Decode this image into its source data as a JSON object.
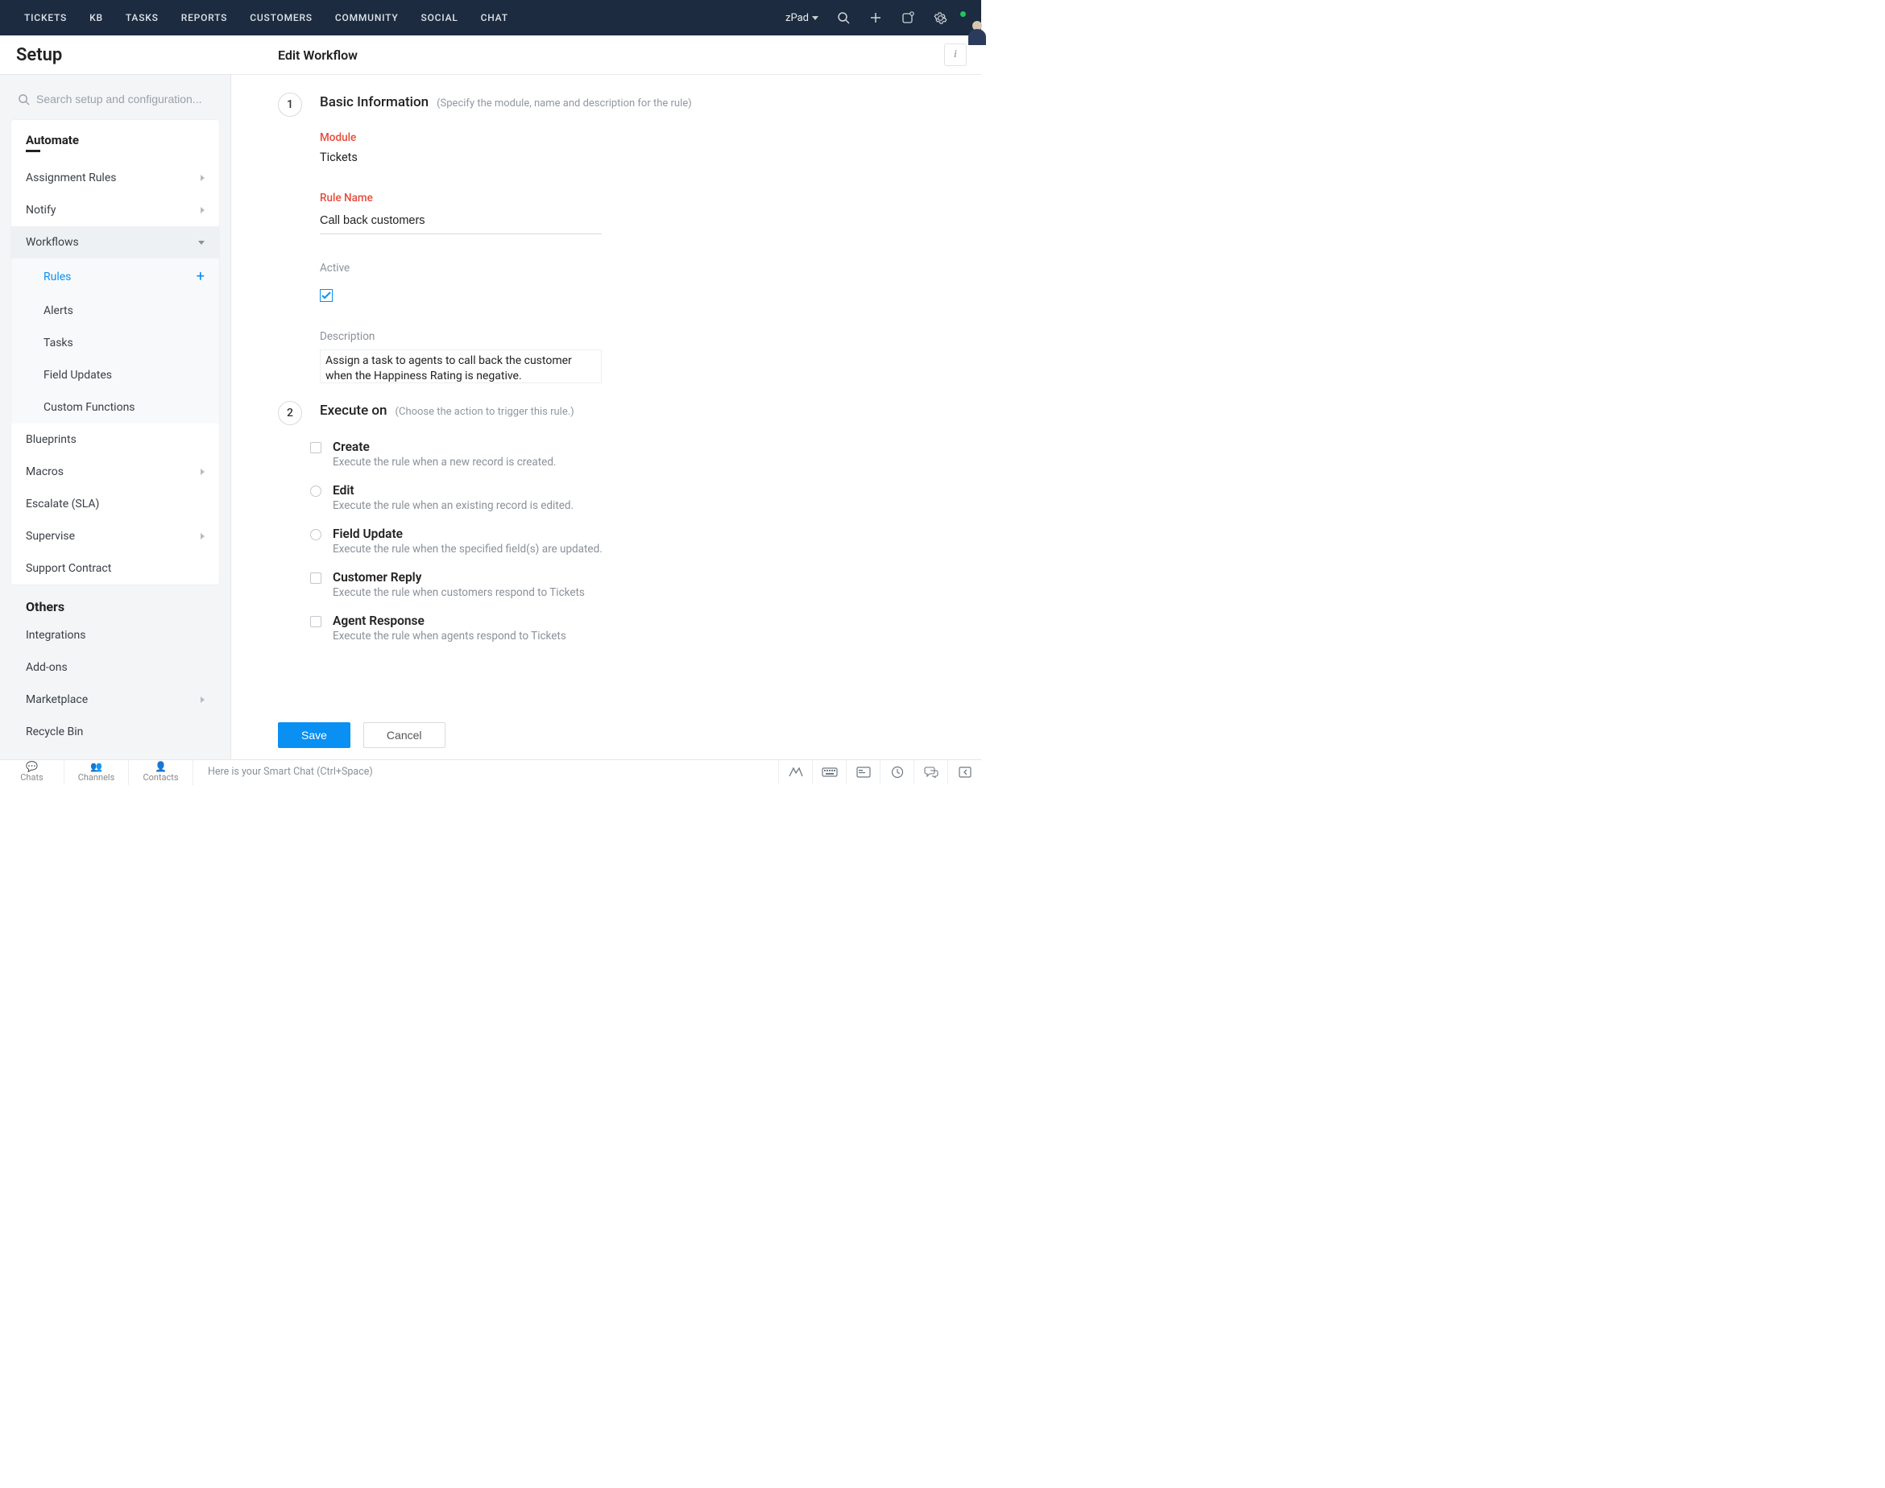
{
  "topnav": {
    "items": [
      "TICKETS",
      "KB",
      "TASKS",
      "REPORTS",
      "CUSTOMERS",
      "COMMUNITY",
      "SOCIAL",
      "CHAT"
    ],
    "workspace": "zPad"
  },
  "page": {
    "app_label": "Setup",
    "title": "Edit Workflow"
  },
  "sidebar": {
    "search_placeholder": "Search setup and configuration...",
    "automate_header": "Automate",
    "automate": [
      {
        "label": "Assignment Rules",
        "type": "item",
        "caret": true
      },
      {
        "label": "Notify",
        "type": "item",
        "caret": true
      },
      {
        "label": "Workflows",
        "type": "item",
        "caret": "down",
        "expanded": true,
        "children": [
          {
            "label": "Rules",
            "active": true,
            "addable": true
          },
          {
            "label": "Alerts"
          },
          {
            "label": "Tasks"
          },
          {
            "label": "Field Updates"
          },
          {
            "label": "Custom Functions"
          }
        ]
      },
      {
        "label": "Blueprints",
        "type": "item",
        "caret": false
      },
      {
        "label": "Macros",
        "type": "item",
        "caret": true
      },
      {
        "label": "Escalate (SLA)",
        "type": "item",
        "caret": false
      },
      {
        "label": "Supervise",
        "type": "item",
        "caret": true
      },
      {
        "label": "Support Contract",
        "type": "item",
        "caret": false
      }
    ],
    "others_header": "Others",
    "others": [
      {
        "label": "Integrations"
      },
      {
        "label": "Add-ons"
      },
      {
        "label": "Marketplace",
        "caret": true
      },
      {
        "label": "Recycle Bin"
      }
    ]
  },
  "step1": {
    "num": "1",
    "title": "Basic Information",
    "hint": "(Specify the module, name and description for the rule)",
    "module_label": "Module",
    "module_value": "Tickets",
    "rulename_label": "Rule Name",
    "rulename_value": "Call back customers",
    "active_label": "Active",
    "description_label": "Description",
    "description_value": "Assign a task to agents to call back the customer when the Happiness Rating is negative."
  },
  "step2": {
    "num": "2",
    "title": "Execute on",
    "hint": "(Choose the action to trigger this rule.)",
    "options": [
      {
        "title": "Create",
        "desc": "Execute the rule when a new record is created.",
        "ctrl": "check"
      },
      {
        "title": "Edit",
        "desc": "Execute the rule when an existing record is edited.",
        "ctrl": "radio"
      },
      {
        "title": "Field Update",
        "desc": "Execute the rule when the specified field(s) are updated.",
        "ctrl": "radio"
      },
      {
        "title": "Customer Reply",
        "desc": "Execute the rule when customers respond to Tickets",
        "ctrl": "check"
      },
      {
        "title": "Agent Response",
        "desc": "Execute the rule when agents respond to Tickets",
        "ctrl": "check"
      }
    ]
  },
  "footer": {
    "save": "Save",
    "cancel": "Cancel"
  },
  "bottombar": {
    "tabs": [
      {
        "label": "Chats",
        "icon": "chat"
      },
      {
        "label": "Channels",
        "icon": "group"
      },
      {
        "label": "Contacts",
        "icon": "user"
      }
    ],
    "smartchat_placeholder": "Here is your Smart Chat (Ctrl+Space)"
  }
}
